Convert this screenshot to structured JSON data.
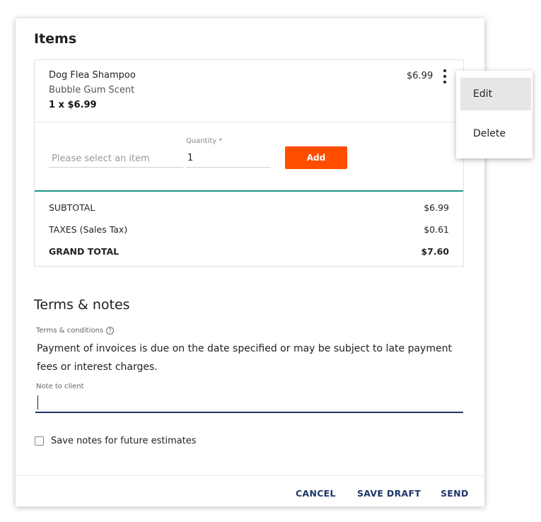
{
  "items_section": {
    "title": "Items",
    "item": {
      "name": "Dog Flea Shampoo",
      "variant": "Bubble Gum Scent",
      "quantity_line": "1 x $6.99",
      "price": "$6.99"
    },
    "add_form": {
      "item_placeholder": "Please select an item",
      "quantity_label": "Quantity *",
      "quantity_value": "1",
      "add_label": "Add"
    },
    "summary": {
      "subtotal_label": "SUBTOTAL",
      "subtotal_value": "$6.99",
      "taxes_label": "TAXES (Sales Tax)",
      "taxes_value": "$0.61",
      "grand_total_label": "GRAND TOTAL",
      "grand_total_value": "$7.60"
    }
  },
  "terms_section": {
    "title": "Terms & notes",
    "terms_label": "Terms & conditions",
    "help_glyph": "?",
    "terms_text": "Payment of invoices is due on the date specified or may be subject to late payment fees or interest charges.",
    "note_label": "Note to client",
    "note_value": "",
    "save_notes_label": "Save notes for future estimates"
  },
  "footer": {
    "cancel_label": "CANCEL",
    "save_draft_label": "SAVE DRAFT",
    "send_label": "SEND"
  },
  "context_menu": {
    "edit_label": "Edit",
    "delete_label": "Delete"
  },
  "colors": {
    "accent_orange": "#ff4d00",
    "accent_teal": "#1a9a8a",
    "navy": "#1d3766"
  },
  "icons": {
    "more": "more-vertical-icon",
    "help": "help-circle-icon"
  }
}
